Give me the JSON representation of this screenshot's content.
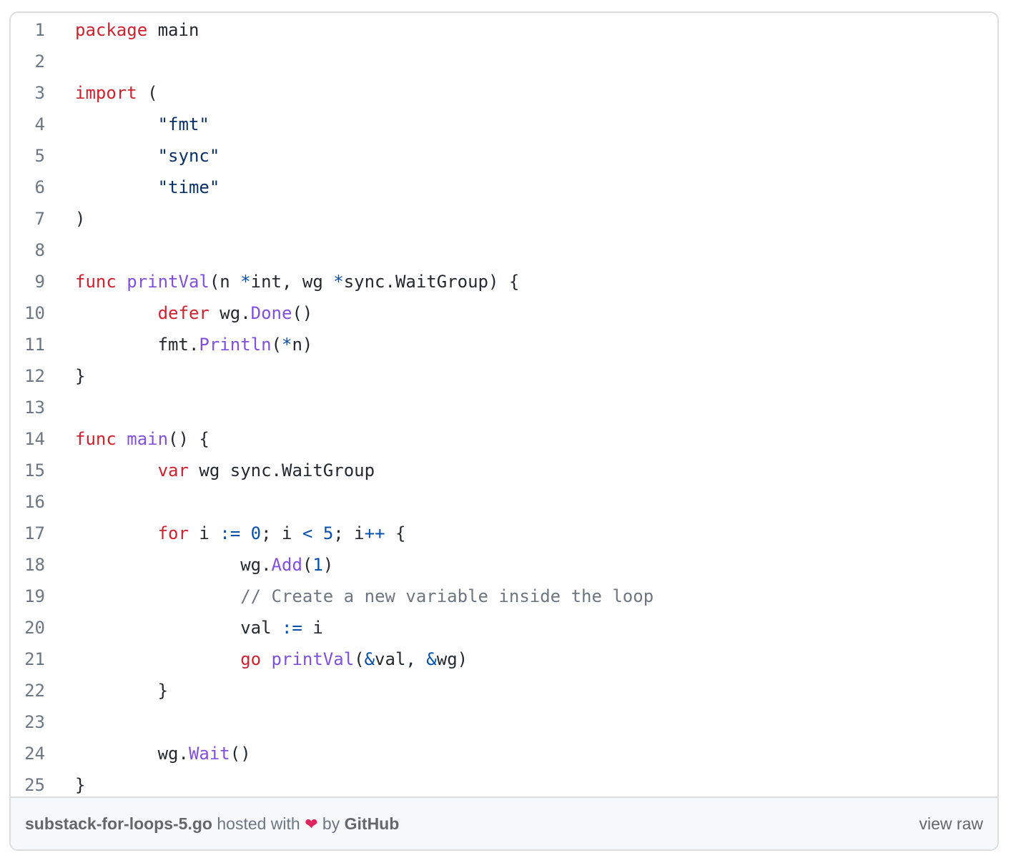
{
  "code_lines": [
    [
      {
        "t": "package",
        "c": "kw"
      },
      {
        "t": " main"
      }
    ],
    [],
    [
      {
        "t": "import",
        "c": "kw"
      },
      {
        "t": " ("
      }
    ],
    [
      {
        "t": "\t"
      },
      {
        "t": "\"fmt\"",
        "c": "str"
      }
    ],
    [
      {
        "t": "\t"
      },
      {
        "t": "\"sync\"",
        "c": "str"
      }
    ],
    [
      {
        "t": "\t"
      },
      {
        "t": "\"time\"",
        "c": "str"
      }
    ],
    [
      {
        "t": ")"
      }
    ],
    [],
    [
      {
        "t": "func",
        "c": "kw"
      },
      {
        "t": " "
      },
      {
        "t": "printVal",
        "c": "fn"
      },
      {
        "t": "(n "
      },
      {
        "t": "*",
        "c": "op"
      },
      {
        "t": "int, wg "
      },
      {
        "t": "*",
        "c": "op"
      },
      {
        "t": "sync.WaitGroup) {"
      }
    ],
    [
      {
        "t": "\t"
      },
      {
        "t": "defer",
        "c": "kw"
      },
      {
        "t": " wg."
      },
      {
        "t": "Done",
        "c": "fn"
      },
      {
        "t": "()"
      }
    ],
    [
      {
        "t": "\tfmt."
      },
      {
        "t": "Println",
        "c": "fn"
      },
      {
        "t": "("
      },
      {
        "t": "*",
        "c": "op"
      },
      {
        "t": "n)"
      }
    ],
    [
      {
        "t": "}"
      }
    ],
    [],
    [
      {
        "t": "func",
        "c": "kw"
      },
      {
        "t": " "
      },
      {
        "t": "main",
        "c": "fn"
      },
      {
        "t": "() {"
      }
    ],
    [
      {
        "t": "\t"
      },
      {
        "t": "var",
        "c": "kw"
      },
      {
        "t": " wg sync.WaitGroup"
      }
    ],
    [],
    [
      {
        "t": "\t"
      },
      {
        "t": "for",
        "c": "kw"
      },
      {
        "t": " i "
      },
      {
        "t": ":=",
        "c": "op"
      },
      {
        "t": " "
      },
      {
        "t": "0",
        "c": "op"
      },
      {
        "t": "; i "
      },
      {
        "t": "<",
        "c": "op"
      },
      {
        "t": " "
      },
      {
        "t": "5",
        "c": "op"
      },
      {
        "t": "; i"
      },
      {
        "t": "++",
        "c": "op"
      },
      {
        "t": " {"
      }
    ],
    [
      {
        "t": "\t\twg."
      },
      {
        "t": "Add",
        "c": "fn"
      },
      {
        "t": "("
      },
      {
        "t": "1",
        "c": "op"
      },
      {
        "t": ")"
      }
    ],
    [
      {
        "t": "\t\t"
      },
      {
        "t": "// Create a new variable inside the loop",
        "c": "cm"
      }
    ],
    [
      {
        "t": "\t\tval "
      },
      {
        "t": ":=",
        "c": "op"
      },
      {
        "t": " i"
      }
    ],
    [
      {
        "t": "\t\t"
      },
      {
        "t": "go",
        "c": "kw"
      },
      {
        "t": " "
      },
      {
        "t": "printVal",
        "c": "fn"
      },
      {
        "t": "("
      },
      {
        "t": "&",
        "c": "op"
      },
      {
        "t": "val, "
      },
      {
        "t": "&",
        "c": "op"
      },
      {
        "t": "wg)"
      }
    ],
    [
      {
        "t": "\t}"
      }
    ],
    [],
    [
      {
        "t": "\twg."
      },
      {
        "t": "Wait",
        "c": "fn"
      },
      {
        "t": "()"
      }
    ],
    [
      {
        "t": "}"
      }
    ]
  ],
  "footer": {
    "file_name": "substack-for-loops-5.go",
    "hosted_text": " hosted with ",
    "heart": "❤",
    "by_text": " by ",
    "github": "GitHub",
    "view_raw": "view raw"
  }
}
